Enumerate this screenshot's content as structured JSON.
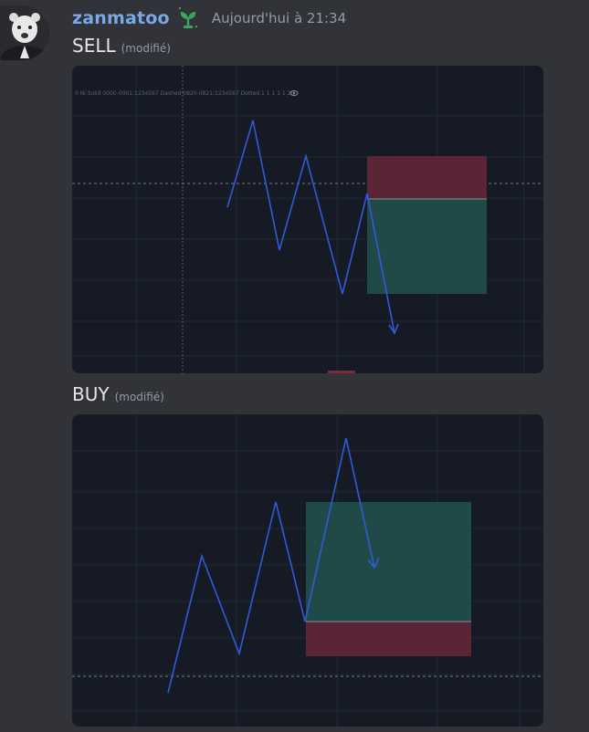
{
  "author": {
    "username": "zanmatoo",
    "badge_icon": "sprout-icon",
    "timestamp": "Aujourd'hui à 21:34"
  },
  "messages": [
    {
      "text": "SELL",
      "edited_label": "(modifié)"
    },
    {
      "text": "BUY",
      "edited_label": "(modifié)"
    }
  ],
  "charts": {
    "sell": {
      "legend_text": "0 Ni Solid 0000-0001:1234567 Dashed 0820-0821:1234567 Dotted 1 1 1 1 1 20",
      "legend_icon": "eye-icon",
      "zone_colors": {
        "stop": "#5a2636",
        "target": "#1f4a47"
      },
      "line_color": "#2f5bd8"
    },
    "buy": {
      "zone_colors": {
        "stop": "#5a2636",
        "target": "#1f4a47"
      },
      "line_color": "#2f5bd8"
    }
  },
  "colors": {
    "background": "#313338",
    "username": "#7aa7e6",
    "chart_bg": "#161a25"
  }
}
